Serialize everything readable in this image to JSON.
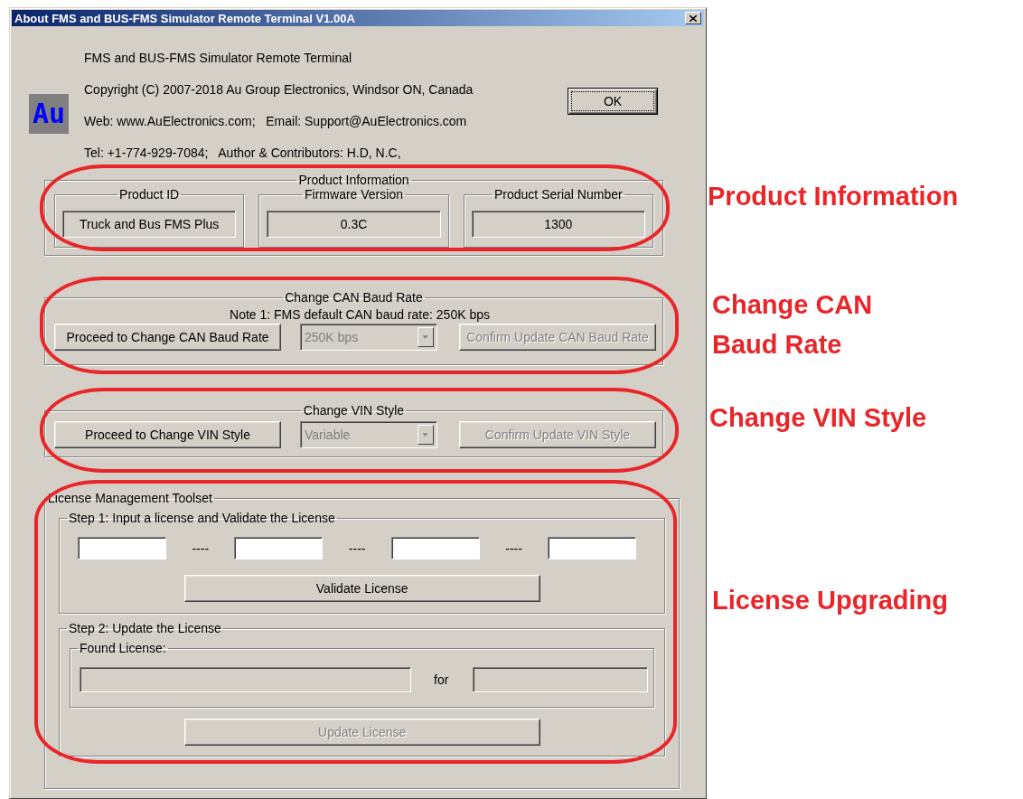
{
  "window": {
    "title": "About FMS and BUS-FMS Simulator Remote Terminal V1.00A"
  },
  "logo": {
    "text": "Au"
  },
  "about_lines": [
    "FMS and BUS-FMS Simulator Remote Terminal",
    "Copyright (C) 2007-2018 Au Group Electronics, Windsor ON, Canada",
    "Web: www.AuElectronics.com;   Email: Support@AuElectronics.com",
    "Tel: +1-774-929-7084;   Author & Contributors: H.D, N.C,"
  ],
  "ok_button": {
    "label": "OK",
    "default": true
  },
  "product_information": {
    "title": "Product Information",
    "items": [
      {
        "label": "Product ID",
        "value": "Truck and Bus FMS Plus"
      },
      {
        "label": "Firmware Version",
        "value": "0.3C"
      },
      {
        "label": "Product Serial Number",
        "value": "1300"
      }
    ]
  },
  "baud_rate": {
    "title": "Change CAN Baud Rate",
    "note": "Note 1: FMS default CAN baud rate: 250K bps",
    "proceed_button": {
      "label": "Proceed to Change CAN Baud Rate",
      "disabled": false
    },
    "dropdown": {
      "value": "250K bps",
      "disabled": true
    },
    "confirm_button": {
      "label": "Confirm Update CAN Baud Rate",
      "disabled": true
    }
  },
  "vin_style": {
    "title": "Change VIN Style",
    "proceed_button": {
      "label": "Proceed to Change VIN Style",
      "disabled": false
    },
    "dropdown": {
      "value": "Variable",
      "disabled": true
    },
    "confirm_button": {
      "label": "Confirm Update VIN Style",
      "disabled": true
    }
  },
  "license": {
    "title": "License Management Toolset",
    "step1": {
      "title": "Step 1: Input a license and Validate the License",
      "fields": [
        {
          "disabled": false
        },
        {
          "disabled": false
        },
        {
          "disabled": false
        },
        {
          "disabled": false
        }
      ],
      "separators": [
        "----",
        "----",
        "----"
      ],
      "validate_button": {
        "label": "Validate License",
        "disabled": false
      }
    },
    "step2": {
      "title": "Step 2: Update the License",
      "found_license": {
        "title": "Found License:",
        "license_field": {
          "disabled": true
        },
        "for_label": "for",
        "target_field": {
          "disabled": true
        }
      },
      "update_button": {
        "label": "Update License",
        "disabled": true
      }
    }
  },
  "annotations": [
    {
      "label": "Product Information"
    },
    {
      "label": "Change CAN Baud Rate"
    },
    {
      "label": "Change VIN Style"
    },
    {
      "label": "License Upgrading"
    }
  ]
}
